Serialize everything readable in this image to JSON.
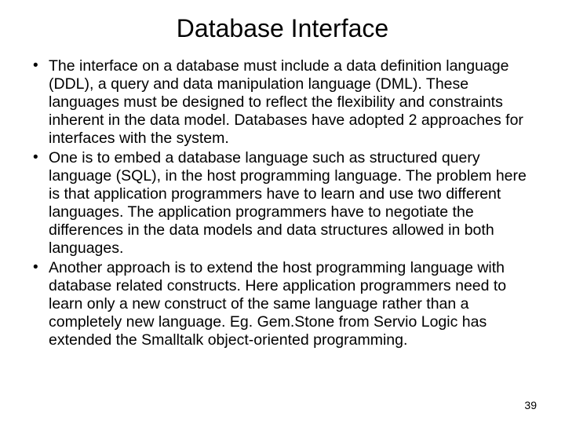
{
  "title": "Database Interface",
  "bullets": [
    "The interface on a database must include a data definition language (DDL), a query and data manipulation language (DML).  These languages must be designed to reflect the flexibility and constraints inherent in the data model.  Databases have adopted 2 approaches for interfaces with the system.",
    "One is to embed a database language such as structured query language (SQL), in the host programming language.  The problem here is that application programmers have to learn and use two different languages.  The application programmers have to negotiate the differences in the data models and data structures allowed in both languages.",
    "Another approach is to extend the host programming language with database related constructs.  Here application programmers need to learn only a new construct of the same language rather than a completely new language.  Eg. Gem.Stone from Servio Logic has extended the Smalltalk object-oriented programming."
  ],
  "page_number": "39"
}
